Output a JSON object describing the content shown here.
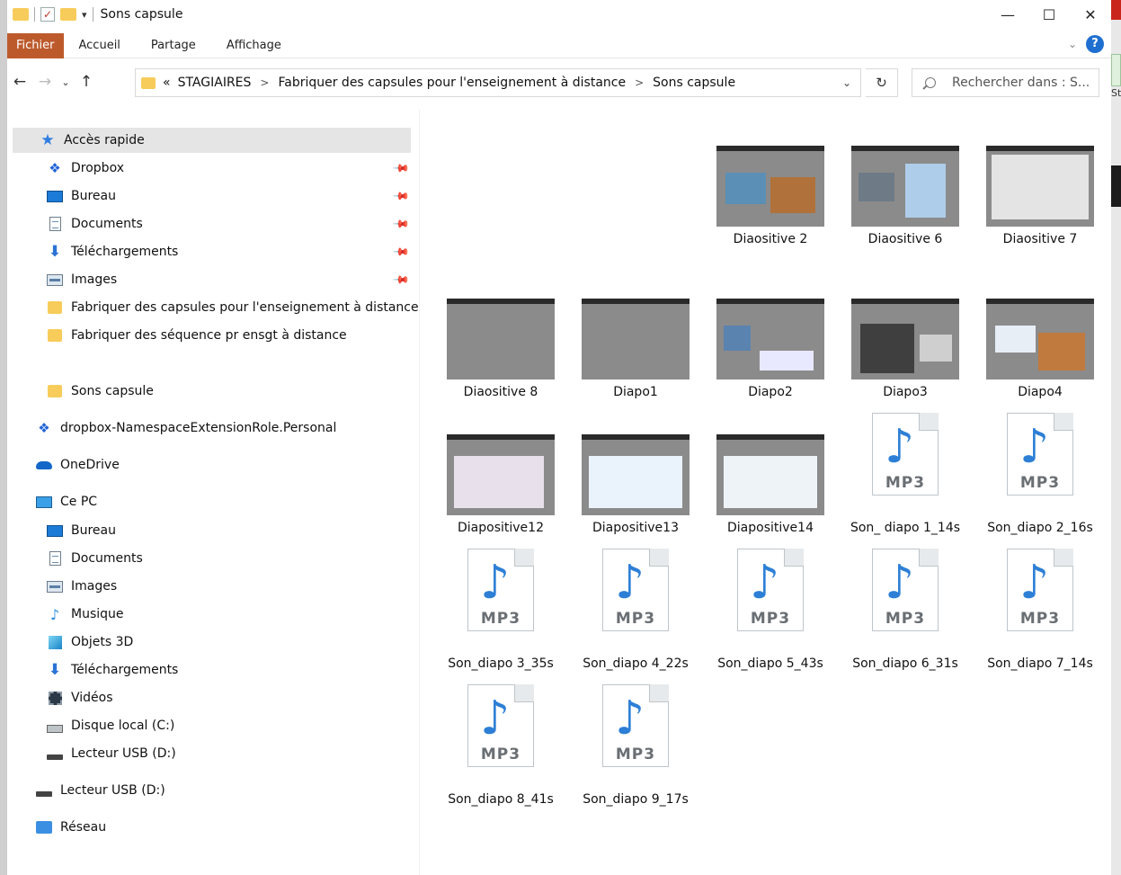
{
  "window": {
    "title": "Sons capsule",
    "controls": {
      "minimize": "—",
      "maximize": "☐",
      "close": "✕"
    }
  },
  "ribbon": {
    "tabs": [
      "Fichier",
      "Accueil",
      "Partage",
      "Affichage"
    ]
  },
  "address": {
    "overflow": "«",
    "crumbs": [
      "STAGIAIRES",
      "Fabriquer des capsules pour l'enseignement à distance",
      "Sons capsule"
    ],
    "separator": ">"
  },
  "search": {
    "placeholder": "Rechercher dans : S..."
  },
  "navpane": {
    "quick_access": "Accès rapide",
    "pinned": [
      {
        "label": "Dropbox",
        "icon": "dropbox-icon"
      },
      {
        "label": "Bureau",
        "icon": "desktop-icon"
      },
      {
        "label": "Documents",
        "icon": "documents-icon"
      },
      {
        "label": "Téléchargements",
        "icon": "downloads-icon"
      },
      {
        "label": "Images",
        "icon": "pictures-icon"
      }
    ],
    "recent_folders": [
      "Fabriquer des capsules pour l'enseignement à distance",
      "Fabriquer des séquence pr ensgt à distance",
      "Sons capsule"
    ],
    "dropbox_ns": "dropbox-NamespaceExtensionRole.Personal",
    "onedrive": "OneDrive",
    "this_pc": "Ce PC",
    "pc_items": [
      {
        "label": "Bureau",
        "icon": "desktop-icon"
      },
      {
        "label": "Documents",
        "icon": "documents-icon"
      },
      {
        "label": "Images",
        "icon": "pictures-icon"
      },
      {
        "label": "Musique",
        "icon": "music-icon"
      },
      {
        "label": "Objets 3D",
        "icon": "3d-objects-icon"
      },
      {
        "label": "Téléchargements",
        "icon": "downloads-icon"
      },
      {
        "label": "Vidéos",
        "icon": "videos-icon"
      },
      {
        "label": "Disque local (C:)",
        "icon": "local-disk-icon"
      },
      {
        "label": "Lecteur USB (D:)",
        "icon": "usb-drive-icon"
      }
    ],
    "usb_root": "Lecteur USB (D:)",
    "network": "Réseau"
  },
  "files": {
    "row1": [
      "Diaositive 2",
      "Diaositive 6",
      "Diaositive 7"
    ],
    "row2": [
      "Diaositive 8",
      "Diapo1",
      "Diapo2",
      "Diapo3",
      "Diapo4"
    ],
    "row3_images": [
      "Diapositive12",
      "Diapositive13",
      "Diapositive14"
    ],
    "row3_audio": [
      "Son_ diapo 1_14s",
      "Son_diapo 2_16s"
    ],
    "row4_audio": [
      "Son_diapo 3_35s",
      "Son_diapo 4_22s",
      "Son_diapo 5_43s",
      "Son_diapo 6_31s",
      "Son_diapo 7_14s"
    ],
    "row5_audio": [
      "Son_diapo 8_41s",
      "Son_diapo 9_17s"
    ],
    "audio_badge": "MP3"
  },
  "colors": {
    "file_tab": "#bd5a2c",
    "selection": "#e5e5e5",
    "folder": "#f7cc5a",
    "accent": "#1f6fd1"
  },
  "external": {
    "partial_text": "Sty pi"
  }
}
